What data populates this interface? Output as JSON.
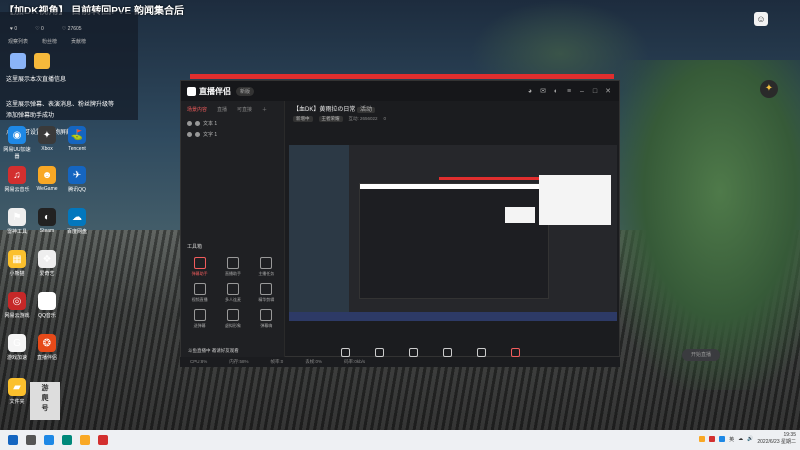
{
  "stream": {
    "title": "【加DK视角】 目前转回PVE 韵闻集合后",
    "stats": [
      "♥ 0",
      "♡ 0",
      "♡ 27605"
    ],
    "tabs": [
      "观察列表",
      "粉丝榜",
      "贡献榜"
    ],
    "msg1": "这里展示本次直播信息",
    "msg2": "这里展示弹幕、表演消息、粉丝牌升级等",
    "msg3": "添加弹幕助手成功",
    "msg4": "点击即可设置小礼物屏蔽"
  },
  "desktop_icons": [
    {
      "label": "网易UU加速器",
      "color": "#1e88e5",
      "glyph": "◉"
    },
    {
      "label": "Xbox",
      "color": "#3a3a3a",
      "glyph": "✦"
    },
    {
      "label": "Tencent",
      "color": "#1565c0",
      "glyph": "⛳"
    },
    {
      "label": "网易云音乐",
      "color": "#d32f2f",
      "glyph": "♫"
    },
    {
      "label": "WeGame",
      "color": "#f9a825",
      "glyph": "☻"
    },
    {
      "label": "腾讯QQ",
      "color": "#1565c0",
      "glyph": "✈"
    },
    {
      "label": "雷神工具",
      "color": "#eeeeee",
      "glyph": "⚑"
    },
    {
      "label": "Steam",
      "color": "#222222",
      "glyph": "◐"
    },
    {
      "label": "百度网盘",
      "color": "#0277bd",
      "glyph": "☁"
    },
    {
      "label": "小熊猫",
      "color": "#fbc02d",
      "glyph": "▦"
    },
    {
      "label": "爱奇艺",
      "color": "#eeeeee",
      "glyph": "❖"
    },
    {
      "label": "网易云游戏",
      "color": "#c62828",
      "glyph": "◎"
    },
    {
      "label": "QQ音乐",
      "color": "#ffffff",
      "glyph": "✚"
    },
    {
      "label": "游戏加速",
      "color": "#f5f5f5",
      "glyph": "G"
    },
    {
      "label": "直播伴侣",
      "color": "#e64a19",
      "glyph": "❂"
    },
    {
      "label": "文件夹",
      "color": "#fbc02d",
      "glyph": "▰"
    }
  ],
  "app": {
    "name": "直播伴侣",
    "badge": "新版",
    "side_tabs": [
      "场景内容",
      "直播",
      "可直接"
    ],
    "scenes": [
      "文本 1",
      "文字 1"
    ],
    "tools_title": "工具箱",
    "tools": [
      "弹幕助手",
      "直播助手",
      "主播任务",
      "视频直播",
      "多人连麦",
      "精华剪辑",
      "送弹幕",
      "虚拟形象",
      "弹幕嗨"
    ],
    "stream_name": "【血DK】黄雨拉の日常",
    "stream_tag": "活动",
    "sub": [
      "新增中  ",
      "王者荣耀",
      "互动: 2656022",
      "0"
    ],
    "controls": [
      "直播屏幕",
      "摄像头",
      "手机投屏",
      "新增场景",
      "麦克风",
      "扬声器"
    ],
    "start": "开始直播",
    "share": "斗鱼直播中 邀请好友观看",
    "status": [
      "CPU:8%",
      "内存:58%",
      "帧率:0",
      "丢帧:0%",
      "码率:0kb/s"
    ]
  },
  "logo_text": [
    "游",
    "爬",
    "号"
  ],
  "taskbar": {
    "time": "19:35",
    "date": "2022/6/23 星期二",
    "tray": [
      "英",
      "☁",
      "🔊"
    ]
  }
}
